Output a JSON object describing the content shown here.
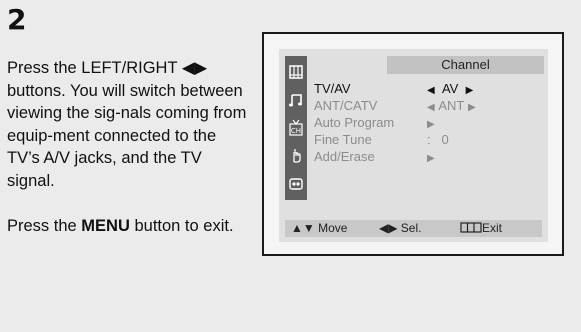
{
  "step": {
    "number": "2",
    "paragraph_1": "Press the LEFT/RIGHT ◀▶ buttons. You will switch between viewing the sig-nals coming from equip-ment connected to the TV’s A/V jacks, and the TV signal.",
    "paragraph_2_prefix": "Press the ",
    "paragraph_2_bold": "MENU",
    "paragraph_2_suffix": " button to exit."
  },
  "osd": {
    "title": "Channel",
    "rows": [
      {
        "label": "TV/AV",
        "value": "AV",
        "left_arrow": "◀",
        "right_arrow": "▶",
        "active": true
      },
      {
        "label": "ANT/CATV",
        "value": "ANT",
        "left_arrow": "◀",
        "right_arrow": "▶",
        "active": false
      },
      {
        "label": "Auto Program",
        "value": "",
        "left_arrow": "",
        "right_arrow": "▶",
        "active": false
      },
      {
        "label": "Fine Tune",
        "value": ":   0",
        "left_arrow": "",
        "right_arrow": "",
        "active": false
      },
      {
        "label": "Add/Erase",
        "value": "",
        "left_arrow": "",
        "right_arrow": "▶",
        "active": false
      }
    ],
    "icons": [
      "picture-icon",
      "sound-icon",
      "channel-icon",
      "setup-icon",
      "function-icon"
    ],
    "status": {
      "move": "▲▼ Move",
      "select": "◀▶ Sel.",
      "exit": "Exit"
    }
  }
}
